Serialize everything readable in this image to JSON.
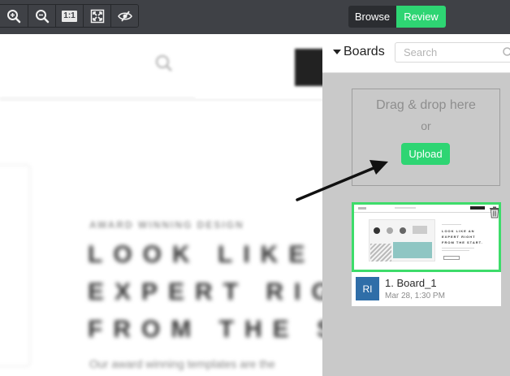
{
  "toolbar": {
    "zoom_in_icon": "zoom-in-icon",
    "zoom_out_icon": "zoom-out-icon",
    "actual_size_label": "1:1",
    "fit_icon": "fit-screen-icon",
    "hide_icon": "eye-slash-icon",
    "browse_label": "Browse",
    "review_label": "Review"
  },
  "background_page": {
    "tag": "AWARD WINNING DESIGN",
    "headline": [
      "LOOK LIKE A",
      "EXPERT RIGH",
      "FROM THE ST"
    ],
    "body": "Our award winning templates are the"
  },
  "panel": {
    "boards_label": "Boards",
    "search_placeholder": "Search",
    "dropzone": {
      "drag_text": "Drag & drop here",
      "or_text": "or",
      "upload_label": "Upload"
    },
    "boards": [
      {
        "avatar": "RI",
        "name": "1. Board_1",
        "date": "Mar 28, 1:30 PM",
        "thumb_headline": [
          "LOOK LIKE AN",
          "EXPERT RIGHT",
          "FROM THE START."
        ]
      }
    ]
  },
  "colors": {
    "accent_green": "#2ed573",
    "toolbar_bg": "#3f4146",
    "panel_bg": "#c9c9c9",
    "avatar_blue": "#2f6ea8"
  }
}
